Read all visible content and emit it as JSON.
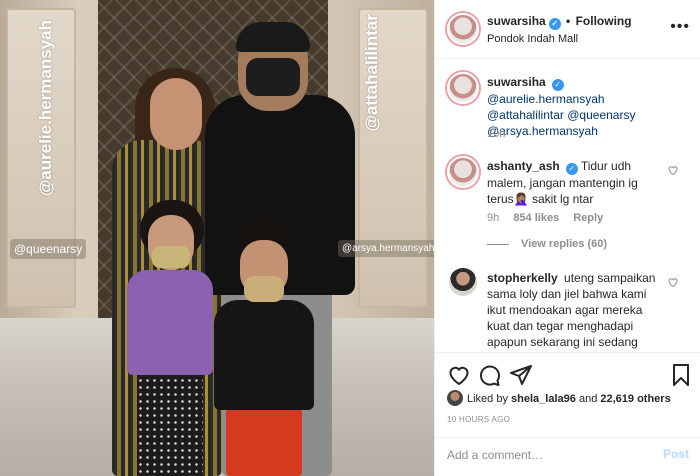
{
  "photo": {
    "tags": {
      "aurelie": "@aurelie.hermansyah",
      "attah": "@attahalilintar",
      "queenarsy": "@queenarsy",
      "arsya": "@arsya.hermansyah"
    }
  },
  "header": {
    "username": "suwarsiha",
    "separator": "•",
    "follow_status": "Following",
    "location": "Pondok Indah Mall",
    "more_icon": "more-horizontal-icon"
  },
  "caption": {
    "username": "suwarsiha",
    "text_mentions": [
      "@aurelie.hermansyah",
      "@attahalilintar",
      "@queenarsy",
      "@arsya.hermansyah"
    ],
    "time": "10h"
  },
  "comments": [
    {
      "username": "ashanty_ash",
      "text": "Tidur udh malem, jangan mantengin ig terus🤦🏽‍♀️ sakit lg ntar",
      "time": "9h",
      "likes": "854 likes",
      "reply_label": "Reply",
      "view_replies": "View replies (60)"
    },
    {
      "username": "stopherkelly",
      "text": "uteng sampaikan sama loly dan jiel bahwa kami ikut mendoakan agar mereka kuat dan tegar menghadapi apapun sekarang ini sedang mereka rasakan , kami juga mendoakan"
    }
  ],
  "actions": {
    "liked_by_prefix": "Liked by",
    "liked_by_user": "shela_lala96",
    "liked_by_and": "and",
    "liked_by_others": "22,619 others",
    "timestamp": "10 HOURS AGO"
  },
  "add_comment": {
    "placeholder": "Add a comment…",
    "post_label": "Post"
  },
  "colors": {
    "link": "#00376b",
    "verified": "#3897f0",
    "post_disabled": "#b3dbff",
    "muted": "#8e8e8e"
  }
}
